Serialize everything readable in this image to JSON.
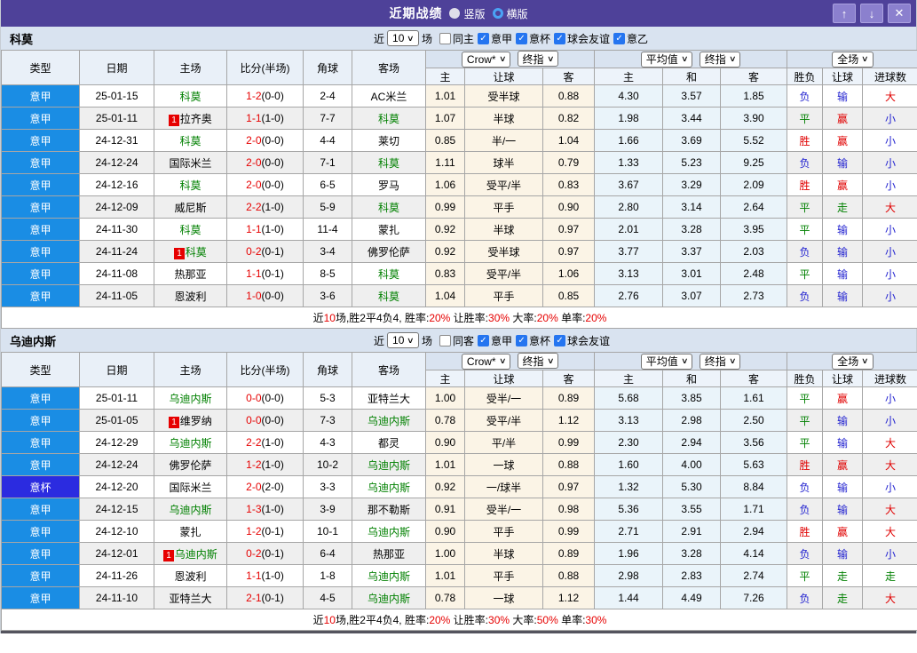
{
  "titlebar": {
    "title": "近期战绩",
    "radio_vertical": "竖版",
    "radio_horizontal": "横版"
  },
  "window_controls": {
    "up": "↑",
    "down": "↓",
    "close": "✕"
  },
  "filter_labels": {
    "recent": "近",
    "matches": "场"
  },
  "card_badge": "1",
  "colors": {
    "league": {
      "blue": "#1a8de4",
      "purple": "#2b2be0"
    },
    "result": {
      "胜": "#e00000",
      "平": "#008000",
      "负": "#2323d0",
      "赢": "#e00000",
      "输": "#2323d0",
      "走": "#008000",
      "大": "#e00000",
      "小": "#2323d0"
    },
    "team_green": "#008000",
    "score_red": "#e60000"
  },
  "table_header": {
    "col_type": "类型",
    "col_date": "日期",
    "col_home": "主场",
    "col_score": "比分(半场)",
    "col_corner": "角球",
    "col_away": "客场",
    "bookmaker": "Crow*",
    "stage1": "终指",
    "avg": "平均值",
    "stage2": "终指",
    "scope": "全场",
    "sub": [
      "主",
      "让球",
      "客",
      "主",
      "和",
      "客",
      "胜负",
      "让球",
      "进球数"
    ]
  },
  "sections": [
    {
      "team": "科莫",
      "recent_count": "10",
      "same_venue_label": "同主",
      "same_venue_checked": false,
      "leagues": [
        {
          "label": "意甲",
          "checked": true
        },
        {
          "label": "意杯",
          "checked": true
        },
        {
          "label": "球会友谊",
          "checked": true
        },
        {
          "label": "意乙",
          "checked": true
        }
      ],
      "rows": [
        {
          "lg": "意甲",
          "lgc": "blue",
          "date": "25-01-15",
          "home": "科莫",
          "hg": 1,
          "hb": 0,
          "score": "1-2",
          "half": "(0-0)",
          "cn": "2-4",
          "away": "AC米兰",
          "ag": 0,
          "oh": "1.01",
          "hc": "受半球",
          "oa": "0.88",
          "ah": "4.30",
          "ad": "3.57",
          "aa": "1.85",
          "r": "负",
          "hr": "输",
          "g": "大"
        },
        {
          "lg": "意甲",
          "lgc": "blue",
          "date": "25-01-11",
          "home": "拉齐奥",
          "hg": 0,
          "hb": 1,
          "score": "1-1",
          "half": "(1-0)",
          "cn": "7-7",
          "away": "科莫",
          "ag": 1,
          "oh": "1.07",
          "hc": "半球",
          "oa": "0.82",
          "ah": "1.98",
          "ad": "3.44",
          "aa": "3.90",
          "r": "平",
          "hr": "赢",
          "g": "小"
        },
        {
          "lg": "意甲",
          "lgc": "blue",
          "date": "24-12-31",
          "home": "科莫",
          "hg": 1,
          "hb": 0,
          "score": "2-0",
          "half": "(0-0)",
          "cn": "4-4",
          "away": "莱切",
          "ag": 0,
          "oh": "0.85",
          "hc": "半/一",
          "oa": "1.04",
          "ah": "1.66",
          "ad": "3.69",
          "aa": "5.52",
          "r": "胜",
          "hr": "赢",
          "g": "小"
        },
        {
          "lg": "意甲",
          "lgc": "blue",
          "date": "24-12-24",
          "home": "国际米兰",
          "hg": 0,
          "hb": 0,
          "score": "2-0",
          "half": "(0-0)",
          "cn": "7-1",
          "away": "科莫",
          "ag": 1,
          "oh": "1.11",
          "hc": "球半",
          "oa": "0.79",
          "ah": "1.33",
          "ad": "5.23",
          "aa": "9.25",
          "r": "负",
          "hr": "输",
          "g": "小"
        },
        {
          "lg": "意甲",
          "lgc": "blue",
          "date": "24-12-16",
          "home": "科莫",
          "hg": 1,
          "hb": 0,
          "score": "2-0",
          "half": "(0-0)",
          "cn": "6-5",
          "away": "罗马",
          "ag": 0,
          "oh": "1.06",
          "hc": "受平/半",
          "oa": "0.83",
          "ah": "3.67",
          "ad": "3.29",
          "aa": "2.09",
          "r": "胜",
          "hr": "赢",
          "g": "小"
        },
        {
          "lg": "意甲",
          "lgc": "blue",
          "date": "24-12-09",
          "home": "威尼斯",
          "hg": 0,
          "hb": 0,
          "score": "2-2",
          "half": "(1-0)",
          "cn": "5-9",
          "away": "科莫",
          "ag": 1,
          "oh": "0.99",
          "hc": "平手",
          "oa": "0.90",
          "ah": "2.80",
          "ad": "3.14",
          "aa": "2.64",
          "r": "平",
          "hr": "走",
          "g": "大"
        },
        {
          "lg": "意甲",
          "lgc": "blue",
          "date": "24-11-30",
          "home": "科莫",
          "hg": 1,
          "hb": 0,
          "score": "1-1",
          "half": "(1-0)",
          "cn": "11-4",
          "away": "蒙扎",
          "ag": 0,
          "oh": "0.92",
          "hc": "半球",
          "oa": "0.97",
          "ah": "2.01",
          "ad": "3.28",
          "aa": "3.95",
          "r": "平",
          "hr": "输",
          "g": "小"
        },
        {
          "lg": "意甲",
          "lgc": "blue",
          "date": "24-11-24",
          "home": "科莫",
          "hg": 1,
          "hb": 1,
          "score": "0-2",
          "half": "(0-1)",
          "cn": "3-4",
          "away": "佛罗伦萨",
          "ag": 0,
          "oh": "0.92",
          "hc": "受半球",
          "oa": "0.97",
          "ah": "3.77",
          "ad": "3.37",
          "aa": "2.03",
          "r": "负",
          "hr": "输",
          "g": "小"
        },
        {
          "lg": "意甲",
          "lgc": "blue",
          "date": "24-11-08",
          "home": "热那亚",
          "hg": 0,
          "hb": 0,
          "score": "1-1",
          "half": "(0-1)",
          "cn": "8-5",
          "away": "科莫",
          "ag": 1,
          "oh": "0.83",
          "hc": "受平/半",
          "oa": "1.06",
          "ah": "3.13",
          "ad": "3.01",
          "aa": "2.48",
          "r": "平",
          "hr": "输",
          "g": "小"
        },
        {
          "lg": "意甲",
          "lgc": "blue",
          "date": "24-11-05",
          "home": "恩波利",
          "hg": 0,
          "hb": 0,
          "score": "1-0",
          "half": "(0-0)",
          "cn": "3-6",
          "away": "科莫",
          "ag": 1,
          "oh": "1.04",
          "hc": "平手",
          "oa": "0.85",
          "ah": "2.76",
          "ad": "3.07",
          "aa": "2.73",
          "r": "负",
          "hr": "输",
          "g": "小"
        }
      ],
      "summary": [
        [
          "近",
          "k"
        ],
        [
          "10",
          "r"
        ],
        [
          "场,胜2平4负4, 胜率:",
          "k"
        ],
        [
          "20%",
          "r"
        ],
        [
          " 让胜率:",
          "k"
        ],
        [
          "30%",
          "r"
        ],
        [
          " 大率:",
          "k"
        ],
        [
          "20%",
          "r"
        ],
        [
          " 单率:",
          "k"
        ],
        [
          "20%",
          "r"
        ]
      ]
    },
    {
      "team": "乌迪内斯",
      "recent_count": "10",
      "same_venue_label": "同客",
      "same_venue_checked": false,
      "leagues": [
        {
          "label": "意甲",
          "checked": true
        },
        {
          "label": "意杯",
          "checked": true
        },
        {
          "label": "球会友谊",
          "checked": true
        }
      ],
      "rows": [
        {
          "lg": "意甲",
          "lgc": "blue",
          "date": "25-01-11",
          "home": "乌迪内斯",
          "hg": 1,
          "hb": 0,
          "score": "0-0",
          "half": "(0-0)",
          "cn": "5-3",
          "away": "亚特兰大",
          "ag": 0,
          "oh": "1.00",
          "hc": "受半/一",
          "oa": "0.89",
          "ah": "5.68",
          "ad": "3.85",
          "aa": "1.61",
          "r": "平",
          "hr": "赢",
          "g": "小"
        },
        {
          "lg": "意甲",
          "lgc": "blue",
          "date": "25-01-05",
          "home": "维罗纳",
          "hg": 0,
          "hb": 1,
          "score": "0-0",
          "half": "(0-0)",
          "cn": "7-3",
          "away": "乌迪内斯",
          "ag": 1,
          "oh": "0.78",
          "hc": "受平/半",
          "oa": "1.12",
          "ah": "3.13",
          "ad": "2.98",
          "aa": "2.50",
          "r": "平",
          "hr": "输",
          "g": "小"
        },
        {
          "lg": "意甲",
          "lgc": "blue",
          "date": "24-12-29",
          "home": "乌迪内斯",
          "hg": 1,
          "hb": 0,
          "score": "2-2",
          "half": "(1-0)",
          "cn": "4-3",
          "away": "都灵",
          "ag": 0,
          "oh": "0.90",
          "hc": "平/半",
          "oa": "0.99",
          "ah": "2.30",
          "ad": "2.94",
          "aa": "3.56",
          "r": "平",
          "hr": "输",
          "g": "大"
        },
        {
          "lg": "意甲",
          "lgc": "blue",
          "date": "24-12-24",
          "home": "佛罗伦萨",
          "hg": 0,
          "hb": 0,
          "score": "1-2",
          "half": "(1-0)",
          "cn": "10-2",
          "away": "乌迪内斯",
          "ag": 1,
          "oh": "1.01",
          "hc": "一球",
          "oa": "0.88",
          "ah": "1.60",
          "ad": "4.00",
          "aa": "5.63",
          "r": "胜",
          "hr": "赢",
          "g": "大"
        },
        {
          "lg": "意杯",
          "lgc": "purple",
          "date": "24-12-20",
          "home": "国际米兰",
          "hg": 0,
          "hb": 0,
          "score": "2-0",
          "half": "(2-0)",
          "cn": "3-3",
          "away": "乌迪内斯",
          "ag": 1,
          "oh": "0.92",
          "hc": "一/球半",
          "oa": "0.97",
          "ah": "1.32",
          "ad": "5.30",
          "aa": "8.84",
          "r": "负",
          "hr": "输",
          "g": "小"
        },
        {
          "lg": "意甲",
          "lgc": "blue",
          "date": "24-12-15",
          "home": "乌迪内斯",
          "hg": 1,
          "hb": 0,
          "score": "1-3",
          "half": "(1-0)",
          "cn": "3-9",
          "away": "那不勒斯",
          "ag": 0,
          "oh": "0.91",
          "hc": "受半/一",
          "oa": "0.98",
          "ah": "5.36",
          "ad": "3.55",
          "aa": "1.71",
          "r": "负",
          "hr": "输",
          "g": "大"
        },
        {
          "lg": "意甲",
          "lgc": "blue",
          "date": "24-12-10",
          "home": "蒙扎",
          "hg": 0,
          "hb": 0,
          "score": "1-2",
          "half": "(0-1)",
          "cn": "10-1",
          "away": "乌迪内斯",
          "ag": 1,
          "oh": "0.90",
          "hc": "平手",
          "oa": "0.99",
          "ah": "2.71",
          "ad": "2.91",
          "aa": "2.94",
          "r": "胜",
          "hr": "赢",
          "g": "大"
        },
        {
          "lg": "意甲",
          "lgc": "blue",
          "date": "24-12-01",
          "home": "乌迪内斯",
          "hg": 1,
          "hb": 1,
          "score": "0-2",
          "half": "(0-1)",
          "cn": "6-4",
          "away": "热那亚",
          "ag": 0,
          "oh": "1.00",
          "hc": "半球",
          "oa": "0.89",
          "ah": "1.96",
          "ad": "3.28",
          "aa": "4.14",
          "r": "负",
          "hr": "输",
          "g": "小"
        },
        {
          "lg": "意甲",
          "lgc": "blue",
          "date": "24-11-26",
          "home": "恩波利",
          "hg": 0,
          "hb": 0,
          "score": "1-1",
          "half": "(1-0)",
          "cn": "1-8",
          "away": "乌迪内斯",
          "ag": 1,
          "oh": "1.01",
          "hc": "平手",
          "oa": "0.88",
          "ah": "2.98",
          "ad": "2.83",
          "aa": "2.74",
          "r": "平",
          "hr": "走",
          "g": "走"
        },
        {
          "lg": "意甲",
          "lgc": "blue",
          "date": "24-11-10",
          "home": "亚特兰大",
          "hg": 0,
          "hb": 0,
          "score": "2-1",
          "half": "(0-1)",
          "cn": "4-5",
          "away": "乌迪内斯",
          "ag": 1,
          "oh": "0.78",
          "hc": "一球",
          "oa": "1.12",
          "ah": "1.44",
          "ad": "4.49",
          "aa": "7.26",
          "r": "负",
          "hr": "走",
          "g": "大"
        }
      ],
      "summary": [
        [
          "近",
          "k"
        ],
        [
          "10",
          "r"
        ],
        [
          "场,胜2平4负4, 胜率:",
          "k"
        ],
        [
          "20%",
          "r"
        ],
        [
          " 让胜率:",
          "k"
        ],
        [
          "30%",
          "r"
        ],
        [
          " 大率:",
          "k"
        ],
        [
          "50%",
          "r"
        ],
        [
          " 单率:",
          "k"
        ],
        [
          "30%",
          "r"
        ]
      ]
    }
  ]
}
